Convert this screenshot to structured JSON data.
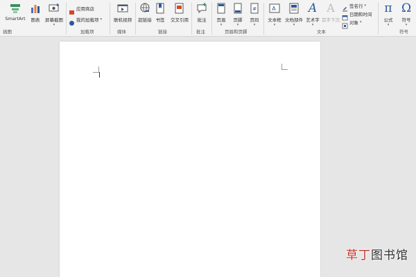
{
  "ribbon": {
    "groups": {
      "illustrations": "插图",
      "addins": "加载项",
      "media": "媒体",
      "links": "链接",
      "comments": "批注",
      "header_footer": "页眉和页脚",
      "text": "文本",
      "symbols": "符号"
    },
    "buttons": {
      "smartart": "SmartArt",
      "chart": "图表",
      "screenshot": "屏幕截图",
      "app_store": "应用商店",
      "my_addins": "我的加载项",
      "online_video": "联机视频",
      "hyperlink": "超链接",
      "bookmark": "书签",
      "cross_reference": "交叉引用",
      "comment": "批注",
      "header": "页眉",
      "footer": "页脚",
      "page_number": "页码",
      "text_box": "文本框",
      "doc_parts": "文档部件",
      "wordart": "艺术字",
      "drop_cap": "首字下沉",
      "signature_line": "签名行",
      "date_time": "日期和时间",
      "object": "对象",
      "equation": "公式",
      "symbol": "符号"
    },
    "icon_glyphs": {
      "wordart": "A",
      "drop_cap": "A",
      "equation": "π",
      "symbol": "Ω"
    }
  },
  "watermark": {
    "part1": "草丁",
    "part2": "图书馆"
  },
  "colors": {
    "ribbon_bg": "#f3f3f3",
    "workspace_bg": "#e6e6e6",
    "accent_blue": "#2b579a",
    "watermark_red": "#c0392b"
  }
}
